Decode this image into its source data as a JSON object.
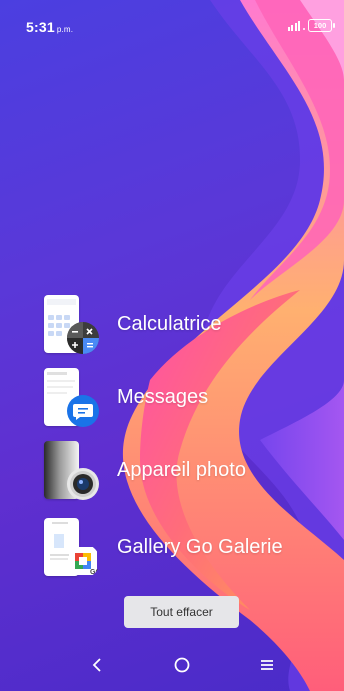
{
  "status_bar": {
    "time": "5:31",
    "time_suffix": "p.m.",
    "battery": "100",
    "icons": [
      "signal-icon",
      "battery-icon"
    ]
  },
  "recent_apps": [
    {
      "label": "Calculatrice",
      "icon": "calculator-icon"
    },
    {
      "label": "Messages",
      "icon": "messages-icon"
    },
    {
      "label": "Appareil photo",
      "icon": "camera-icon"
    },
    {
      "label": "Gallery Go Galerie",
      "icon": "gallery-go-icon",
      "icon_text": "GO"
    }
  ],
  "clear_button": {
    "label": "Tout effacer"
  },
  "nav_bar": {
    "icons": [
      "back-icon",
      "home-icon",
      "recents-icon"
    ]
  },
  "colors": {
    "background": "#5a38d8",
    "accent_pink": "#ff5a8a",
    "accent_orange": "#ff8a5a",
    "messages_blue": "#1a73e8"
  }
}
